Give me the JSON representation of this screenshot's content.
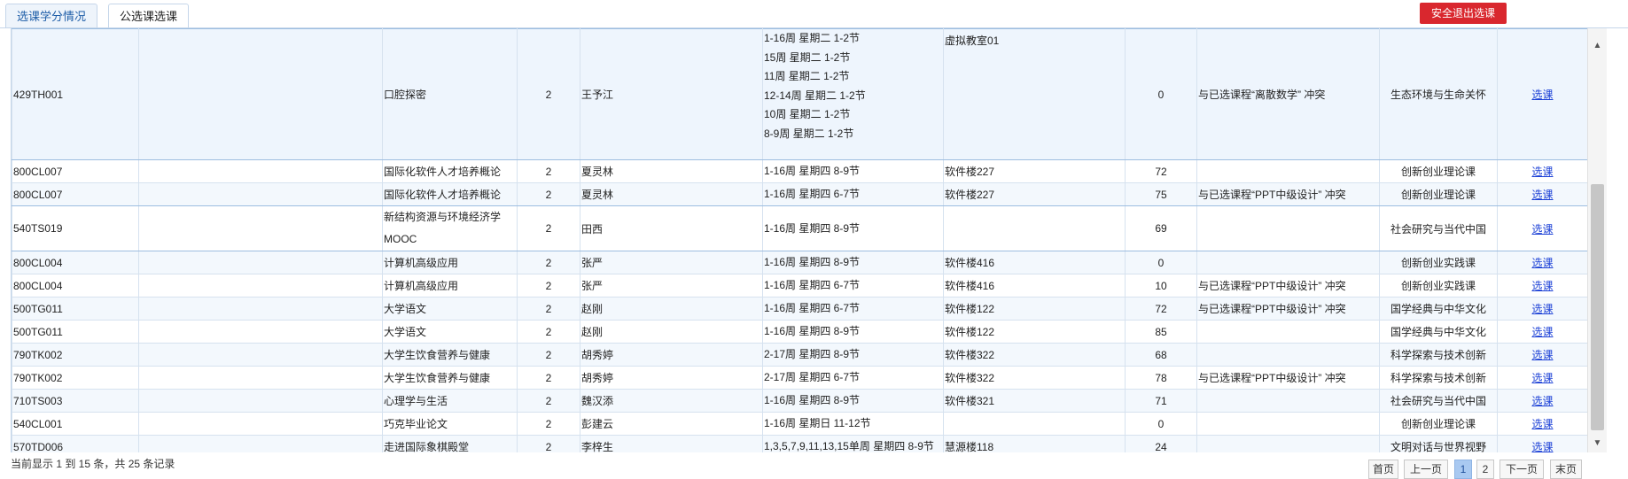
{
  "tabs": {
    "credit_status": "选课学分情况",
    "public_course": "公选课选课"
  },
  "exit_button": "安全退出选课",
  "rows": [
    {
      "code": "429TH001",
      "name": "口腔探密",
      "credit": "2",
      "teacher": "王予江",
      "time_lines": [
        "1-16周 星期二 1-2节",
        "15周 星期二 1-2节",
        "11周 星期二 1-2节",
        "12-14周 星期二 1-2节",
        "10周 星期二 1-2节",
        "8-9周 星期二 1-2节"
      ],
      "place": "虚拟教室01",
      "remaining": "0",
      "conflict": "与已选课程“离散数学” 冲突",
      "category": "生态环境与生命关怀",
      "action": "选课"
    },
    {
      "code": "800CL007",
      "name": "国际化软件人才培养概论",
      "credit": "2",
      "teacher": "夏灵林",
      "time_lines": [
        "1-16周 星期四 8-9节"
      ],
      "place": "软件楼227",
      "remaining": "72",
      "conflict": "",
      "category": "创新创业理论课",
      "action": "选课"
    },
    {
      "code": "800CL007",
      "name": "国际化软件人才培养概论",
      "credit": "2",
      "teacher": "夏灵林",
      "time_lines": [
        "1-16周 星期四 6-7节"
      ],
      "place": "软件楼227",
      "remaining": "75",
      "conflict": "与已选课程“PPT中级设计” 冲突",
      "category": "创新创业理论课",
      "action": "选课"
    },
    {
      "code": "540TS019",
      "name_lines": [
        "新结构资源与环境经济学",
        "MOOC"
      ],
      "credit": "2",
      "teacher": "田西",
      "time_lines": [
        "1-16周 星期四 8-9节"
      ],
      "place": "",
      "remaining": "69",
      "conflict": "",
      "category": "社会研究与当代中国",
      "action": "选课"
    },
    {
      "code": "800CL004",
      "name": "计算机高级应用",
      "credit": "2",
      "teacher": "张严",
      "time_lines": [
        "1-16周 星期四 8-9节"
      ],
      "place": "软件楼416",
      "remaining": "0",
      "conflict": "",
      "category": "创新创业实践课",
      "action": "选课"
    },
    {
      "code": "800CL004",
      "name": "计算机高级应用",
      "credit": "2",
      "teacher": "张严",
      "time_lines": [
        "1-16周 星期四 6-7节"
      ],
      "place": "软件楼416",
      "remaining": "10",
      "conflict": "与已选课程“PPT中级设计” 冲突",
      "category": "创新创业实践课",
      "action": "选课"
    },
    {
      "code": "500TG011",
      "name": "大学语文",
      "credit": "2",
      "teacher": "赵刚",
      "time_lines": [
        "1-16周 星期四 6-7节"
      ],
      "place": "软件楼122",
      "remaining": "72",
      "conflict": "与已选课程“PPT中级设计” 冲突",
      "category": "国学经典与中华文化",
      "action": "选课"
    },
    {
      "code": "500TG011",
      "name": "大学语文",
      "credit": "2",
      "teacher": "赵刚",
      "time_lines": [
        "1-16周 星期四 8-9节"
      ],
      "place": "软件楼122",
      "remaining": "85",
      "conflict": "",
      "category": "国学经典与中华文化",
      "action": "选课"
    },
    {
      "code": "790TK002",
      "name": "大学生饮食营养与健康",
      "credit": "2",
      "teacher": "胡秀婷",
      "time_lines": [
        "2-17周 星期四 8-9节"
      ],
      "place": "软件楼322",
      "remaining": "68",
      "conflict": "",
      "category": "科学探索与技术创新",
      "action": "选课"
    },
    {
      "code": "790TK002",
      "name": "大学生饮食营养与健康",
      "credit": "2",
      "teacher": "胡秀婷",
      "time_lines": [
        "2-17周 星期四 6-7节"
      ],
      "place": "软件楼322",
      "remaining": "78",
      "conflict": "与已选课程“PPT中级设计” 冲突",
      "category": "科学探索与技术创新",
      "action": "选课"
    },
    {
      "code": "710TS003",
      "name": "心理学与生活",
      "credit": "2",
      "teacher": "魏汉添",
      "time_lines": [
        "1-16周 星期四 8-9节"
      ],
      "place": "软件楼321",
      "remaining": "71",
      "conflict": "",
      "category": "社会研究与当代中国",
      "action": "选课"
    },
    {
      "code": "540CL001",
      "name": "巧克毕业论文",
      "credit": "2",
      "teacher": "彭建云",
      "time_lines": [
        "1-16周 星期日 11-12节"
      ],
      "place": "",
      "remaining": "0",
      "conflict": "",
      "category": "创新创业理论课",
      "action": "选课"
    },
    {
      "code": "570TD006",
      "name": "走进国际象棋殿堂",
      "credit": "2",
      "teacher": "李梓生",
      "time_lines": [
        "1,3,5,7,9,11,13,15单周 星期四 8-9节"
      ],
      "place": "慧源楼118",
      "remaining": "24",
      "conflict": "",
      "category": "文明对话与世界视野",
      "action": "选课"
    }
  ],
  "footer": {
    "info": "当前显示 1 到 15 条，共 25 条记录",
    "first": "首页",
    "prev": "上一页",
    "page1": "1",
    "page2": "2",
    "next": "下一页",
    "last": "末页"
  }
}
